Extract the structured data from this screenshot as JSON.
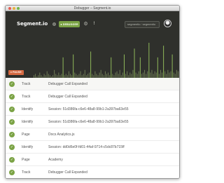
{
  "window": {
    "title": "Debugger – Segment.io"
  },
  "header": {
    "logo": "Segment.io",
    "debugger_button": "DEBUGGER",
    "debugger_icon": "bug-icon",
    "settings_icon": "gear-icon",
    "info_icon": "info-icon",
    "account": "segmentio",
    "project": "segmentio",
    "pause_button": "PAUSE"
  },
  "colors": {
    "header_bg": "#2f302c",
    "accent_green": "#7ba345",
    "pause_orange": "#d66a43"
  },
  "events": [
    {
      "type": "Track",
      "detail": "Debugger Call Expanded",
      "icon": "check-icon"
    },
    {
      "type": "Track",
      "detail": "Debugger Call Expanded",
      "icon": "check-icon"
    },
    {
      "type": "Identify",
      "detail": "Session: 51d386fa-c6e6-48a8-99b1-2a397ba63e55",
      "icon": "check-icon"
    },
    {
      "type": "Identify",
      "detail": "Session: 51d386fa-c6e6-48a8-99b1-2a397ba63e55",
      "icon": "check-icon"
    },
    {
      "type": "Page",
      "detail": "Docs Analytics.js",
      "icon": "check-icon"
    },
    {
      "type": "Identify",
      "detail": "Session: dd0d6e0f-fd01-44af-9714-c5dc87b715ff",
      "icon": "check-icon"
    },
    {
      "type": "Page",
      "detail": "Academy",
      "icon": "check-icon"
    },
    {
      "type": "Track",
      "detail": "Debugger Call Expanded",
      "icon": "check-icon"
    }
  ],
  "activity_levels": [
    2,
    3,
    1,
    2,
    4,
    2,
    1,
    3,
    2,
    5,
    3,
    2,
    1,
    2,
    6,
    3,
    2,
    4,
    2,
    3,
    7,
    2,
    3,
    2,
    5,
    3,
    2,
    8,
    4,
    3,
    2,
    3,
    5,
    2,
    3,
    6,
    2,
    3,
    4,
    9,
    3,
    2,
    5,
    3,
    2,
    4,
    6,
    3,
    2,
    5,
    3,
    4,
    2,
    7,
    3,
    2,
    4,
    5,
    3,
    6,
    2,
    4,
    8,
    3,
    5,
    2,
    4,
    3,
    6,
    10,
    4,
    3,
    5,
    7,
    3,
    4,
    6,
    3,
    5,
    12,
    4,
    6,
    3,
    5,
    4,
    7,
    3,
    6,
    4,
    11,
    5,
    3,
    6,
    4,
    5,
    8,
    4,
    3,
    6,
    5
  ]
}
